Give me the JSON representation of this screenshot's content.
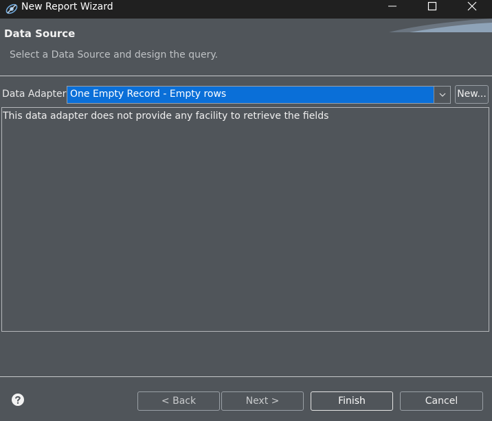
{
  "window": {
    "title": "New Report Wizard",
    "icon": "jaspersoft-studio-icon"
  },
  "header": {
    "title": "Data Source",
    "description": "Select a Data Source and design the query."
  },
  "adapter": {
    "label": "Data Adapter",
    "selected": "One Empty Record - Empty rows",
    "new_label": "New..."
  },
  "info": {
    "text": "This data adapter does not provide any facility to retrieve the fields"
  },
  "footer": {
    "help_icon": "help-icon",
    "back_label": "< Back",
    "next_label": "Next >",
    "finish_label": "Finish",
    "cancel_label": "Cancel"
  },
  "colors": {
    "background": "#50555a",
    "titlebar": "#202020",
    "selection": "#0a6fd8"
  }
}
